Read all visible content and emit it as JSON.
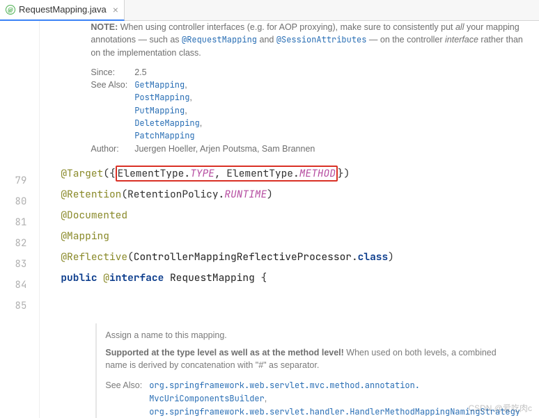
{
  "tab": {
    "name": "RequestMapping.java",
    "icon_label": "@"
  },
  "doc": {
    "note_label": "NOTE:",
    "note_pre": " When using controller interfaces (e.g. for AOP proxying), make sure to consistently put ",
    "note_all": "all",
    "note_mid1": " your mapping annotations — such as ",
    "note_ann1": "@RequestMapping",
    "note_mid2": " and ",
    "note_ann2": "@SessionAttributes",
    "note_mid3": " — on the controller ",
    "note_iface": "interface",
    "note_end": " rather than on the implementation class.",
    "since_label": "Since:",
    "since_value": "2.5",
    "see_label": "See Also:",
    "see_links": [
      "GetMapping",
      "PostMapping",
      "PutMapping",
      "DeleteMapping",
      "PatchMapping"
    ],
    "author_label": "Author:",
    "author_value": "Juergen Hoeller, Arjen Poutsma, Sam Brannen"
  },
  "lines": {
    "numbers": [
      "79",
      "80",
      "81",
      "82",
      "83",
      "84",
      "85"
    ],
    "l79": {
      "ann": "@Target",
      "p1": "({",
      "e1": "ElementType.",
      "c1": "TYPE",
      "comma": ", ",
      "e2": "ElementType.",
      "c2": "METHOD",
      "p2": "})"
    },
    "l80": {
      "ann": "@Retention",
      "p1": "(RetentionPolicy.",
      "c": "RUNTIME",
      "p2": ")"
    },
    "l81": {
      "ann": "@Documented"
    },
    "l82": {
      "ann": "@Mapping"
    },
    "l83": {
      "ann": "@Reflective",
      "p1": "(",
      "cls": "ControllerMappingReflectiveProcessor",
      "dot": ".",
      "kw": "class",
      "p2": ")"
    },
    "l84": {
      "k1": "public ",
      "ann": "@",
      "k2": "interface ",
      "name": "RequestMapping",
      "brace": " {"
    }
  },
  "inner": {
    "title": "Assign a name to this mapping.",
    "bold": "Supported at the type level as well as at the method level!",
    "rest": " When used on both levels, a combined name is derived by concatenation with \"#\" as separator.",
    "see_label": "See Also:",
    "link1a": "org.springframework.web.servlet.mvc.method.annotation.",
    "link1b": "MvcUriComponentsBuilder",
    "link2": "org.springframework.web.servlet.handler.HandlerMethodMappingNamingStrategy"
  },
  "watermark": "CSDN @爱吃肉c"
}
